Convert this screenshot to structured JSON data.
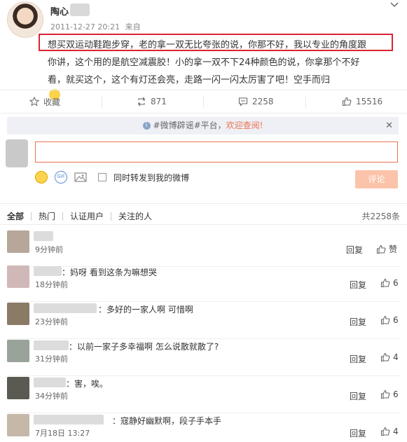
{
  "post": {
    "author": "陶心",
    "timestamp": "2011-12-27 20:21",
    "source_prefix": "来自",
    "lines": [
      "想买双运动鞋跑步穿，老的拿一双无比夸张的说，你那不好，我以专业的角度跟",
      "你讲，这个用的是航空减震胶！小的拿一双不下24种颜色的说，你拿那个不好",
      "看，就买这个，这个有灯还会亮，走路一闪一闪太厉害了吧！空手而归"
    ],
    "emoji_icon": "sad-crying-emoji"
  },
  "actions": {
    "favorite": "收藏",
    "repost": "871",
    "comment": "2258",
    "like": "15516"
  },
  "notice": {
    "tag": "#微博辟谣#平台，",
    "link": "欢迎查阅!"
  },
  "composer": {
    "repost_checkbox_label": "同时转发到我的微博",
    "submit_label": "评论"
  },
  "comment_tabs": [
    "全部",
    "热门",
    "认证用户",
    "关注的人"
  ],
  "comment_count": "共2258条",
  "comments": [
    {
      "text": "",
      "time": "9分钟前",
      "reply": "回复",
      "like": "赞"
    },
    {
      "text": "：妈呀  看到这条为嘛想哭",
      "time": "18分钟前",
      "reply": "回复",
      "like": "6"
    },
    {
      "text": "：多好的一家人啊  可惜啊",
      "time": "23分钟前",
      "reply": "回复",
      "like": "6"
    },
    {
      "text": "：以前一家子多幸福啊 怎么说散就散了?",
      "time": "31分钟前",
      "reply": "回复",
      "like": "4"
    },
    {
      "text": "：害，唉。",
      "time": "34分钟前",
      "reply": "回复",
      "like": "6"
    },
    {
      "text": "：寇静好幽默啊，段子手本手",
      "time": "7月18日 13:27",
      "reply": "回复",
      "like": "4"
    }
  ],
  "colors": {
    "accent": "#eb7350",
    "highlight_border": "#dd2233"
  }
}
